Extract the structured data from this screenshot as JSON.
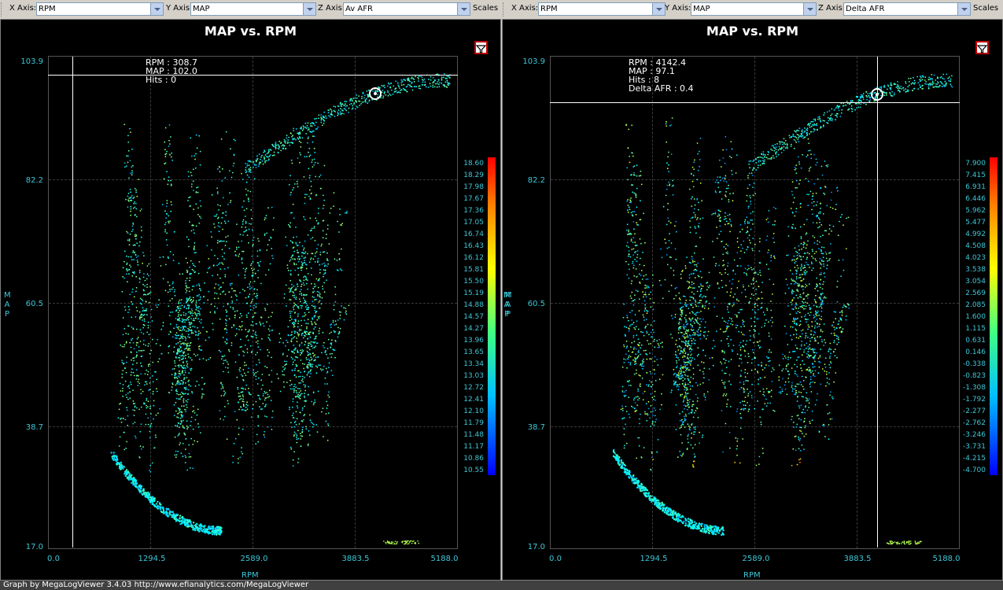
{
  "toolbars": [
    {
      "x_label": "X Axis:",
      "x_value": "RPM",
      "y_label": "Y Axis:",
      "y_value": "MAP",
      "z_label": "Z Axis:",
      "z_value": "Av AFR",
      "scales_label": "Scales"
    },
    {
      "x_label": "X Axis:",
      "x_value": "RPM",
      "y_label": "Y Axis:",
      "y_value": "MAP",
      "z_label": "Z Axis:",
      "z_value": "Delta AFR",
      "scales_label": "Scales"
    }
  ],
  "charts": [
    {
      "title": "MAP vs. RPM",
      "y_axis_label_chars": [
        "M",
        "A",
        "P"
      ],
      "x_axis_label": "RPM",
      "y_ticks": [
        "103.9",
        "82.2",
        "60.5",
        "38.7",
        "17.0"
      ],
      "x_ticks": [
        "0.0",
        "1294.5",
        "2589.0",
        "3883.5",
        "5188.0"
      ],
      "colorbar_values": [
        "18.60",
        "18.29",
        "17.98",
        "17.67",
        "17.36",
        "17.05",
        "16.74",
        "16.43",
        "16.12",
        "15.81",
        "15.50",
        "15.19",
        "14.88",
        "14.57",
        "14.27",
        "13.96",
        "13.65",
        "13.34",
        "13.03",
        "12.72",
        "12.41",
        "12.10",
        "11.79",
        "11.48",
        "11.17",
        "10.86",
        "10.55"
      ],
      "cursor_info": [
        "RPM : 308.7",
        "MAP : 102.0",
        "Hits : 0"
      ],
      "cursor_rpm": 308.7,
      "cursor_map": 102.0
    },
    {
      "title": "MAP vs. RPM",
      "y_axis_label_chars": [
        "M",
        "A",
        "P"
      ],
      "x_axis_label": "RPM",
      "y_ticks": [
        "103.9",
        "82.2",
        "60.5",
        "38.7",
        "17.0"
      ],
      "x_ticks": [
        "0.0",
        "1294.5",
        "2589.0",
        "3883.5",
        "5188.0"
      ],
      "colorbar_values": [
        "7.900",
        "7.415",
        "6.931",
        "6.446",
        "5.962",
        "5.477",
        "4.992",
        "4.508",
        "4.023",
        "3.538",
        "3.054",
        "2.569",
        "2.085",
        "1.600",
        "1.115",
        "0.631",
        "0.146",
        "-0.338",
        "-0.823",
        "-1.308",
        "-1.792",
        "-2.277",
        "-2.762",
        "-3.246",
        "-3.731",
        "-4.215",
        "-4.700"
      ],
      "cursor_info": [
        "RPM : 4142.4",
        "MAP : 97.1",
        "Hits : 8",
        "Delta AFR : 0.4"
      ],
      "cursor_rpm": 4142.4,
      "cursor_map": 97.1
    }
  ],
  "footer": "Graph by MegaLogViewer 3.4.03 http://www.efianalytics.com/MegaLogViewer",
  "colors": {
    "axis_text": "#3cc8d8",
    "background": "#000000",
    "title": "#ffffff"
  },
  "chart_data": [
    {
      "type": "scatter",
      "title": "MAP vs. RPM",
      "xlabel": "RPM",
      "ylabel": "MAP",
      "zlabel": "Av AFR",
      "xlim": [
        0.0,
        5188.0
      ],
      "ylim": [
        17.0,
        103.9
      ],
      "zlim": [
        10.55,
        18.6
      ]
    },
    {
      "type": "scatter",
      "title": "MAP vs. RPM",
      "xlabel": "RPM",
      "ylabel": "MAP",
      "zlabel": "Delta AFR",
      "xlim": [
        0.0,
        5188.0
      ],
      "ylim": [
        17.0,
        103.9
      ],
      "zlim": [
        -4.7,
        7.9
      ]
    }
  ]
}
